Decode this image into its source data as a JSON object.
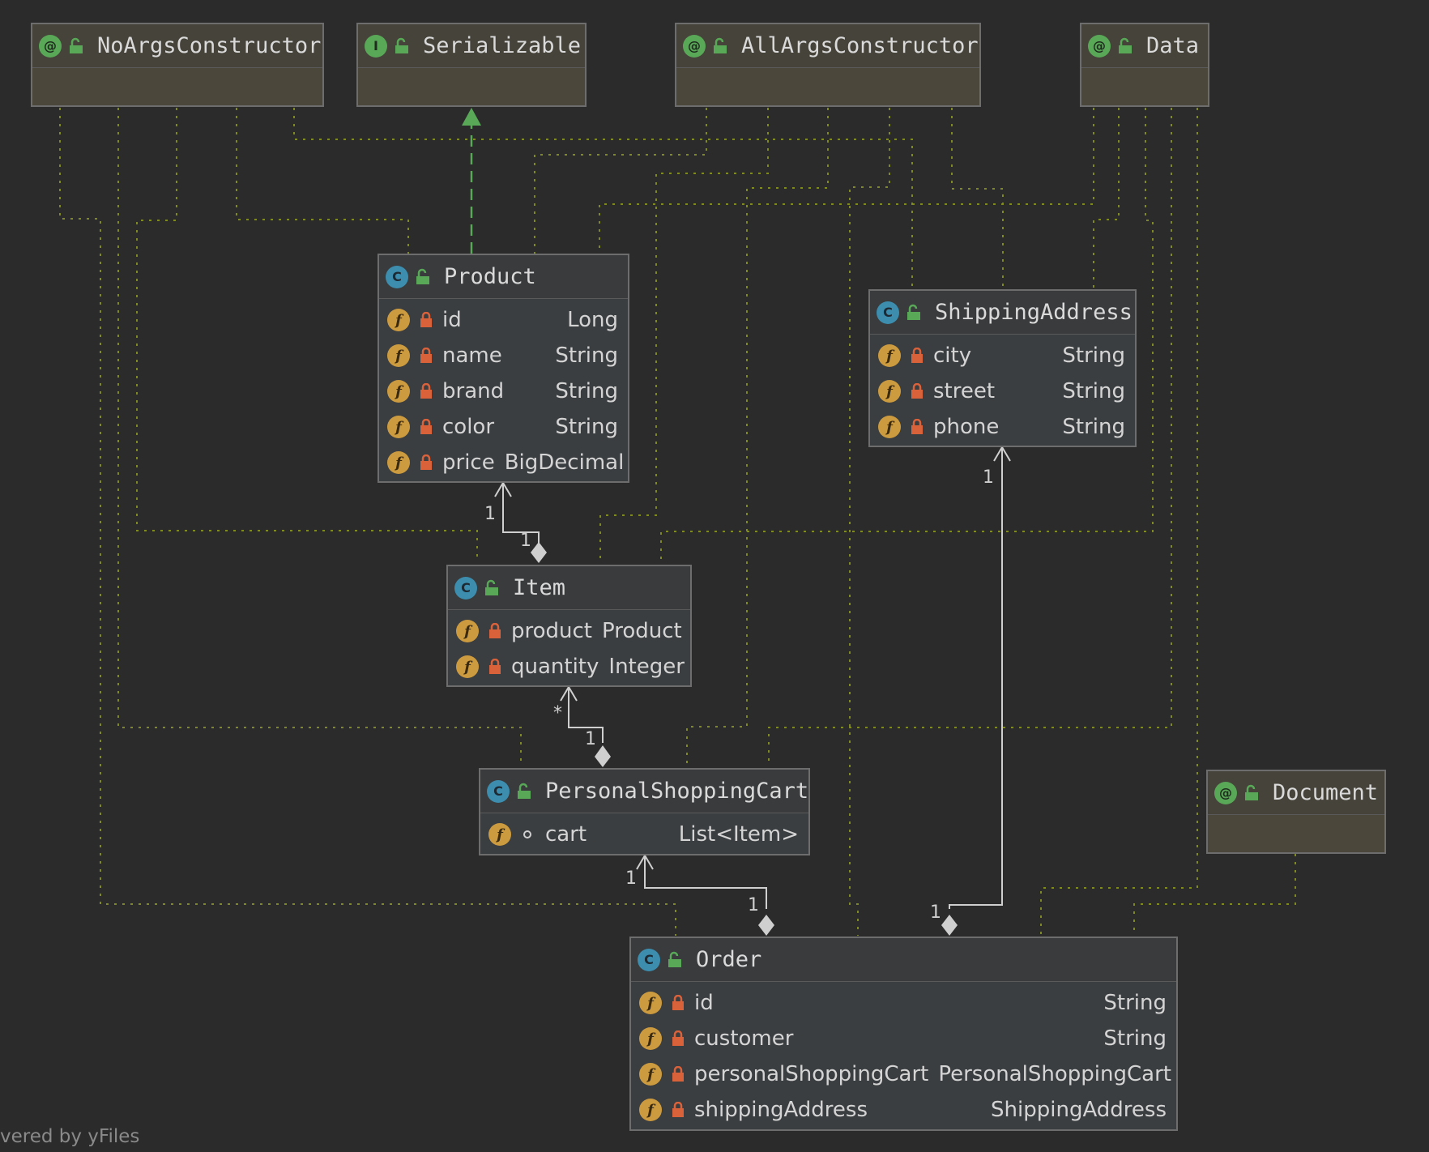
{
  "diagram": {
    "footer": "vered by yFiles",
    "nodes": {
      "noargs": {
        "kind": "annotation",
        "badge": "@",
        "title": "NoArgsConstructor",
        "fields": []
      },
      "serializable": {
        "kind": "interface",
        "badge": "I",
        "title": "Serializable",
        "fields": []
      },
      "allargs": {
        "kind": "annotation",
        "badge": "@",
        "title": "AllArgsConstructor",
        "fields": []
      },
      "data": {
        "kind": "annotation",
        "badge": "@",
        "title": "Data",
        "fields": []
      },
      "document": {
        "kind": "annotation",
        "badge": "@",
        "title": "Document",
        "fields": []
      },
      "product": {
        "kind": "class",
        "badge": "C",
        "title": "Product",
        "fields": [
          {
            "name": "id",
            "type": "Long",
            "access": "private"
          },
          {
            "name": "name",
            "type": "String",
            "access": "private"
          },
          {
            "name": "brand",
            "type": "String",
            "access": "private"
          },
          {
            "name": "color",
            "type": "String",
            "access": "private"
          },
          {
            "name": "price",
            "type": "BigDecimal",
            "access": "private"
          }
        ]
      },
      "shipping": {
        "kind": "class",
        "badge": "C",
        "title": "ShippingAddress",
        "fields": [
          {
            "name": "city",
            "type": "String",
            "access": "private"
          },
          {
            "name": "street",
            "type": "String",
            "access": "private"
          },
          {
            "name": "phone",
            "type": "String",
            "access": "private"
          }
        ]
      },
      "item": {
        "kind": "class",
        "badge": "C",
        "title": "Item",
        "fields": [
          {
            "name": "product",
            "type": "Product",
            "access": "private"
          },
          {
            "name": "quantity",
            "type": "Integer",
            "access": "private"
          }
        ]
      },
      "cart": {
        "kind": "class",
        "badge": "C",
        "title": "PersonalShoppingCart",
        "fields": [
          {
            "name": "cart",
            "type": "List<Item>",
            "access": "package"
          }
        ]
      },
      "order": {
        "kind": "class",
        "badge": "C",
        "title": "Order",
        "fields": [
          {
            "name": "id",
            "type": "String",
            "access": "private"
          },
          {
            "name": "customer",
            "type": "String",
            "access": "private"
          },
          {
            "name": "personalShoppingCart",
            "type": "PersonalShoppingCart",
            "access": "private"
          },
          {
            "name": "shippingAddress",
            "type": "ShippingAddress",
            "access": "private"
          }
        ]
      }
    },
    "relations": [
      {
        "type": "implements",
        "from": "Product",
        "to": "Serializable"
      },
      {
        "type": "composition",
        "from": "Item",
        "to": "Product",
        "source_mult": "1",
        "target_mult": "1"
      },
      {
        "type": "composition",
        "from": "PersonalShoppingCart",
        "to": "Item",
        "source_mult": "1",
        "target_mult": "*"
      },
      {
        "type": "composition",
        "from": "Order",
        "to": "PersonalShoppingCart",
        "source_mult": "1",
        "target_mult": "1"
      },
      {
        "type": "composition",
        "from": "Order",
        "to": "ShippingAddress",
        "source_mult": "1",
        "target_mult": "1"
      },
      {
        "type": "annotated-by",
        "from": "Product",
        "to": [
          "NoArgsConstructor",
          "AllArgsConstructor",
          "Data"
        ]
      },
      {
        "type": "annotated-by",
        "from": "ShippingAddress",
        "to": [
          "NoArgsConstructor",
          "AllArgsConstructor",
          "Data"
        ]
      },
      {
        "type": "annotated-by",
        "from": "Item",
        "to": [
          "NoArgsConstructor",
          "AllArgsConstructor",
          "Data"
        ]
      },
      {
        "type": "annotated-by",
        "from": "PersonalShoppingCart",
        "to": [
          "NoArgsConstructor",
          "AllArgsConstructor",
          "Data"
        ]
      },
      {
        "type": "annotated-by",
        "from": "Order",
        "to": [
          "NoArgsConstructor",
          "AllArgsConstructor",
          "Data",
          "Document"
        ]
      }
    ],
    "colors": {
      "background": "#2b2b2b",
      "annotation_fill": "#4b473a",
      "class_fill": "#3b3e41",
      "dotted_link": "#7f8a23",
      "implements_link": "#59a858",
      "composition_link": "#cfcfcf"
    }
  }
}
